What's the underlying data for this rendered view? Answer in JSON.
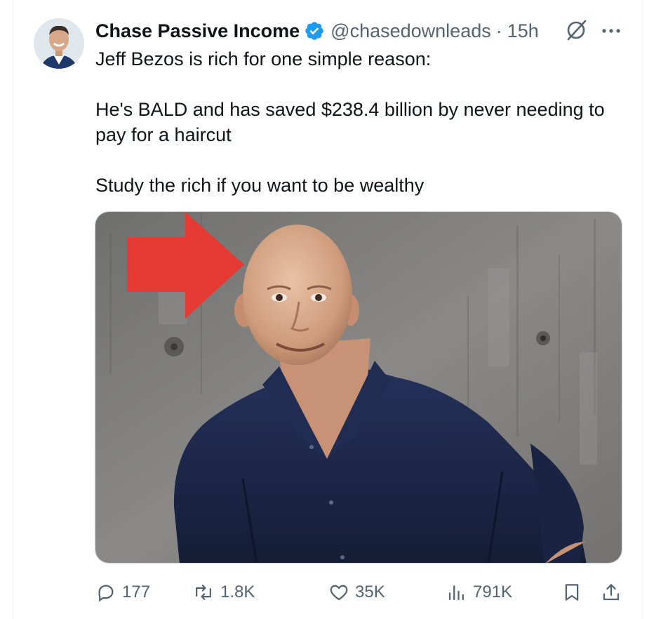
{
  "tweet": {
    "author": {
      "display_name": "Chase Passive Income",
      "handle": "@chasedownleads",
      "verified": true
    },
    "separator": "·",
    "time": "15h",
    "text": {
      "line1": "Jeff Bezos is rich for one simple reason:",
      "line2": "He's BALD and has saved $238.4 billion by never needing to pay for a haircut",
      "line3": "Study the rich if you want to be wealthy"
    }
  },
  "actions": {
    "replies": "177",
    "reposts": "1.8K",
    "likes": "35K",
    "views": "791K"
  },
  "colors": {
    "verified_blue": "#1d9bf0",
    "secondary_text": "#536471",
    "arrow_red": "#e53a33",
    "shirt_navy": "#1d2a4a"
  },
  "icons": [
    "grok-icon",
    "more-icon",
    "reply-icon",
    "repost-icon",
    "like-icon",
    "views-icon",
    "bookmark-icon",
    "share-icon"
  ]
}
